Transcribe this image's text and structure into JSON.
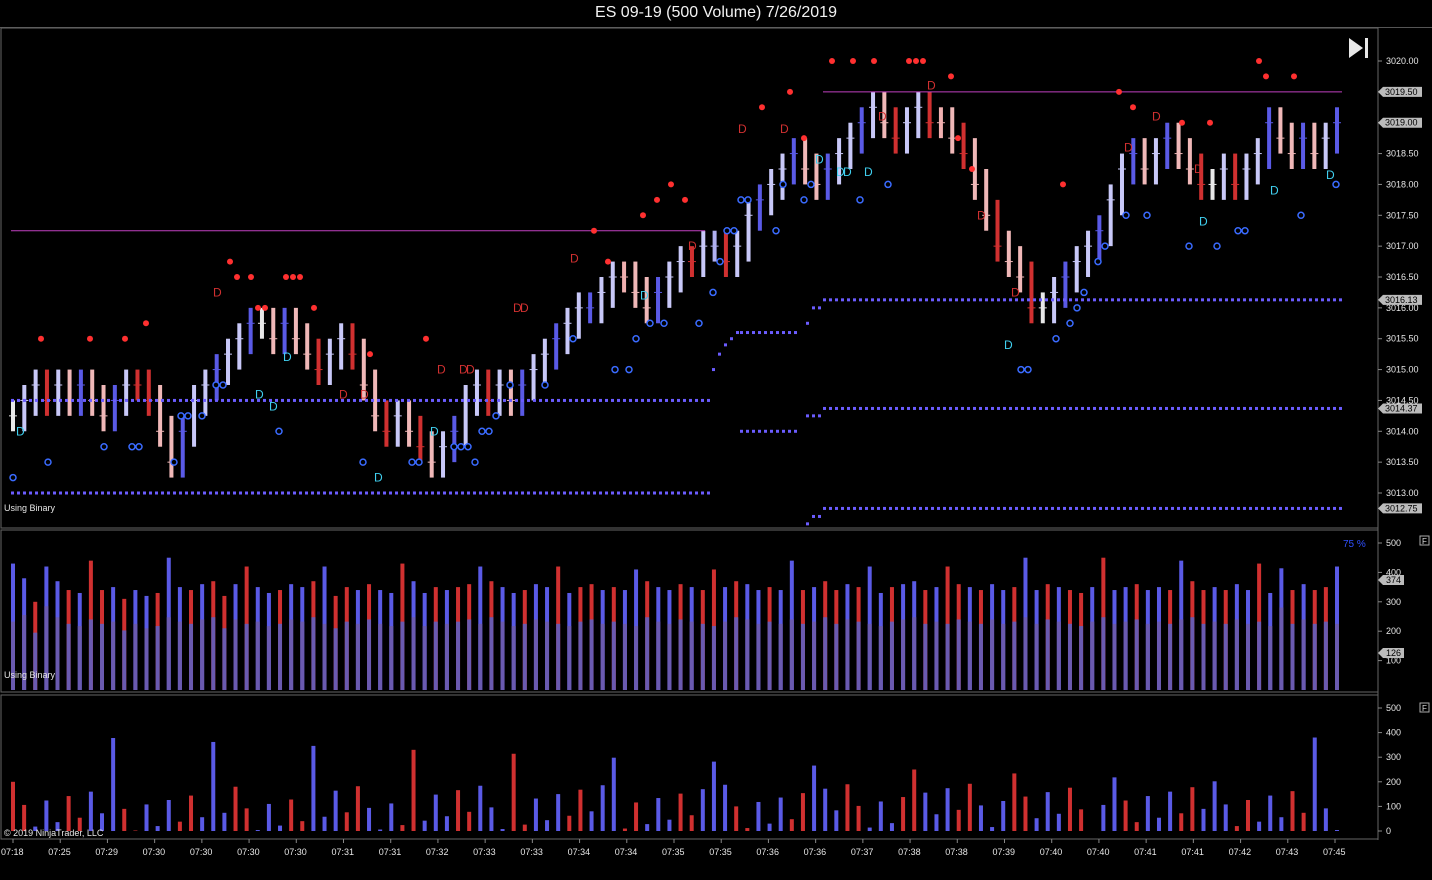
{
  "title": "ES 09-19 (500 Volume)  7/26/2019",
  "copyright": "© 2019 NinjaTrader, LLC",
  "price_panel_label": "Using Binary",
  "volume_panel_label": "Using Binary",
  "volume_percent_label": "75 %",
  "panel_flag": "F",
  "colors": {
    "background": "#000000",
    "up_bar": "#5a5ae6",
    "down_bar": "#d03030",
    "neutral_bar": "#e8e8e8",
    "resistance_line": "#c040c0",
    "level_dots": "#6b5cff",
    "sell_signal": "#ff3030",
    "buy_signal": "#3a6bff",
    "d_marker_red": "#d03030",
    "d_marker_cyan": "#40d0f0",
    "volume_total": "#6a5ab0"
  },
  "icons": {
    "goto_end": "skip-to-end-icon"
  },
  "chart_data": [
    {
      "type": "candlestick",
      "title": "ES 09-19 (500 Volume)  7/26/2019",
      "y_axis": {
        "ylim": [
          3012.6,
          3020.2
        ],
        "ticks": [
          "3020.00",
          "3019.50",
          "3019.00",
          "3018.50",
          "3018.00",
          "3017.50",
          "3017.00",
          "3016.50",
          "3016.00",
          "3015.50",
          "3015.00",
          "3014.50",
          "3014.00",
          "3013.50",
          "3013.00"
        ]
      },
      "price_flags": [
        "3019.50",
        "3019.00",
        "3016.13",
        "3014.37",
        "3012.75"
      ],
      "resistance_lines": [
        3017.25,
        3019.5
      ],
      "close_series": [
        3014.25,
        3014.5,
        3014.75,
        3014.5,
        3014.75,
        3014.5,
        3014.75,
        3014.5,
        3014.25,
        3014.5,
        3014.75,
        3014.75,
        3014.5,
        3014.0,
        3013.5,
        3014.0,
        3014.5,
        3014.75,
        3015.0,
        3015.25,
        3015.5,
        3015.75,
        3015.75,
        3015.5,
        3015.75,
        3015.5,
        3015.25,
        3015.0,
        3015.25,
        3015.5,
        3015.25,
        3014.75,
        3014.25,
        3014.0,
        3014.25,
        3014.0,
        3013.75,
        3013.5,
        3013.75,
        3014.0,
        3014.5,
        3014.75,
        3014.5,
        3014.75,
        3014.5,
        3014.75,
        3015.0,
        3015.25,
        3015.5,
        3015.75,
        3016.0,
        3016.0,
        3016.25,
        3016.5,
        3016.5,
        3016.25,
        3016.0,
        3016.25,
        3016.5,
        3016.75,
        3016.75,
        3017.0,
        3017.0,
        3016.75,
        3017.0,
        3017.5,
        3017.75,
        3018.0,
        3018.25,
        3018.5,
        3018.25,
        3018.0,
        3018.25,
        3018.5,
        3018.75,
        3019.0,
        3019.25,
        3019.0,
        3018.75,
        3019.0,
        3019.25,
        3019.0,
        3019.0,
        3018.75,
        3018.5,
        3018.0,
        3017.5,
        3017.0,
        3016.75,
        3016.5,
        3016.0,
        3016.0,
        3016.25,
        3016.5,
        3016.75,
        3017.0,
        3017.25,
        3017.75,
        3018.25,
        3018.5,
        3018.25,
        3018.5,
        3018.75,
        3018.5,
        3018.25,
        3018.0,
        3018.0,
        3018.25,
        3018.0,
        3018.25,
        3018.5,
        3019.0,
        3018.75,
        3018.5,
        3018.75,
        3018.5,
        3018.75,
        3019.0
      ],
      "support_levels": [
        {
          "from_time": "07:18",
          "to_time": "07:35",
          "levels": [
            3014.5,
            3013.0
          ]
        },
        {
          "from_time": "07:36",
          "to_time": "07:45",
          "levels": [
            3016.13,
            3014.37,
            3012.75
          ]
        }
      ]
    },
    {
      "type": "bar",
      "title": "Volume",
      "y_ticks": [
        "500",
        "400",
        "300",
        "200",
        "100"
      ],
      "value_flags": [
        "374",
        "126"
      ],
      "series": [
        {
          "values": [
            310,
            340,
            260,
            380,
            330,
            300,
            290,
            320,
            300,
            310,
            270,
            300,
            280,
            290,
            330,
            310,
            300,
            320,
            330,
            280,
            320,
            300,
            310,
            290,
            300,
            320,
            310,
            330,
            300,
            280,
            310,
            300,
            320,
            300,
            290,
            310,
            330,
            290,
            310,
            300,
            310,
            320,
            300,
            330,
            310,
            290,
            300,
            320,
            310,
            300,
            290,
            310,
            320,
            300,
            310,
            300,
            290,
            330,
            310,
            300,
            320,
            310,
            300,
            290,
            310,
            330,
            320,
            300,
            310,
            300,
            320,
            300,
            310,
            330,
            300,
            320,
            310,
            300,
            290,
            310,
            320,
            330,
            300,
            310,
            300,
            320,
            310,
            300,
            320,
            300,
            310,
            330,
            300,
            320,
            310,
            300,
            290,
            310,
            330,
            300,
            310,
            320,
            300,
            310,
            300,
            320,
            330,
            300,
            310,
            300,
            320,
            300,
            310,
            290,
            374,
            300,
            320,
            300,
            310,
            300
          ]
        }
      ]
    },
    {
      "type": "bar",
      "title": "Delta",
      "y_ticks": [
        "500",
        "400",
        "300",
        "200",
        "100",
        "0"
      ],
      "x_ticks": [
        "07:18",
        "07:25",
        "07:29",
        "07:30",
        "07:30",
        "07:30",
        "07:30",
        "07:31",
        "07:31",
        "07:32",
        "07:33",
        "07:33",
        "07:34",
        "07:34",
        "07:35",
        "07:35",
        "07:36",
        "07:36",
        "07:37",
        "07:38",
        "07:38",
        "07:39",
        "07:40",
        "07:40",
        "07:41",
        "07:41",
        "07:42",
        "07:43",
        "07:45"
      ]
    }
  ]
}
